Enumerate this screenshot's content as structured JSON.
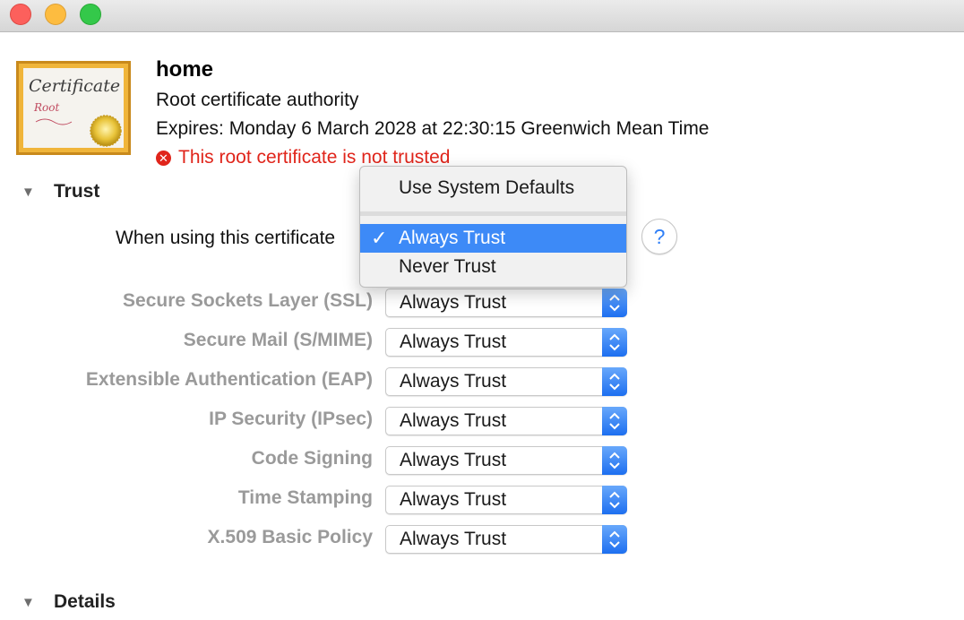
{
  "certificate": {
    "icon_title": "Certificate",
    "icon_subtitle": "Root",
    "name": "home",
    "kind": "Root certificate authority",
    "expires": "Expires: Monday 6 March 2028 at 22:30:15 Greenwich Mean Time",
    "status": "This root certificate is not trusted"
  },
  "trust": {
    "section_title": "Trust",
    "when_using_label": "When using this certificate",
    "help_label": "?",
    "menu": {
      "items": [
        {
          "label": "Use System Defaults",
          "checked": false
        },
        {
          "label": "Always Trust",
          "checked": true
        },
        {
          "label": "Never Trust",
          "checked": false
        }
      ]
    },
    "rows": [
      {
        "label": "Secure Sockets Layer (SSL)",
        "value": "Always Trust"
      },
      {
        "label": "Secure Mail (S/MIME)",
        "value": "Always Trust"
      },
      {
        "label": "Extensible Authentication (EAP)",
        "value": "Always Trust"
      },
      {
        "label": "IP Security (IPsec)",
        "value": "Always Trust"
      },
      {
        "label": "Code Signing",
        "value": "Always Trust"
      },
      {
        "label": "Time Stamping",
        "value": "Always Trust"
      },
      {
        "label": "X.509 Basic Policy",
        "value": "Always Trust"
      }
    ]
  },
  "details": {
    "section_title": "Details"
  },
  "colors": {
    "error": "#e0251b",
    "accent": "#3d8af7",
    "disabled_label": "#9a9a9a"
  }
}
